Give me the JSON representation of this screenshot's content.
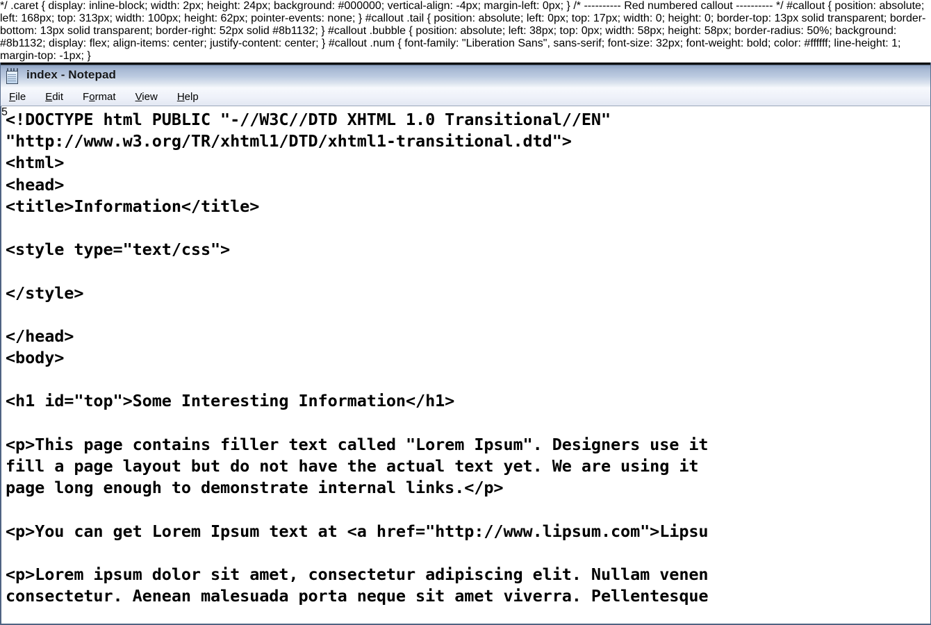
{
  "window": {
    "title": "index - Notepad",
    "icon": "notepad-icon",
    "titlebar_gradient_top": "#8fa4c4",
    "titlebar_gradient_bottom": "#f4f7fb",
    "border_color": "#5b6f8f"
  },
  "menubar": {
    "items": [
      {
        "label": "File",
        "accel": "F"
      },
      {
        "label": "Edit",
        "accel": "E"
      },
      {
        "label": "Format",
        "accel": "o"
      },
      {
        "label": "View",
        "accel": "V"
      },
      {
        "label": "Help",
        "accel": "H"
      }
    ]
  },
  "editor": {
    "font": "monospace-bold",
    "caret_after_line_index": 8,
    "lines": [
      "<!DOCTYPE html PUBLIC \"-//W3C//DTD XHTML 1.0 Transitional//EN\"",
      "\"http://www.w3.org/TR/xhtml1/DTD/xhtml1-transitional.dtd\">",
      "<html>",
      "<head>",
      "<title>Information</title>",
      "",
      "<style type=\"text/css\">",
      "",
      "</style>",
      "",
      "</head>",
      "<body>",
      "",
      "<h1 id=\"top\">Some Interesting Information</h1>",
      "",
      "<p>This page contains filler text called \"Lorem Ipsum\". Designers use it",
      "fill a page layout but do not have the actual text yet. We are using it",
      "page long enough to demonstrate internal links.</p>",
      "",
      "<p>You can get Lorem Ipsum text at <a href=\"http://www.lipsum.com\">Lipsu",
      "",
      "<p>Lorem ipsum dolor sit amet, consectetur adipiscing elit. Nullam venen",
      "consectetur. Aenean malesuada porta neque sit amet viverra. Pellentesque"
    ]
  },
  "callout": {
    "number": "5",
    "color": "#8b1132",
    "text_color": "#ffffff"
  }
}
